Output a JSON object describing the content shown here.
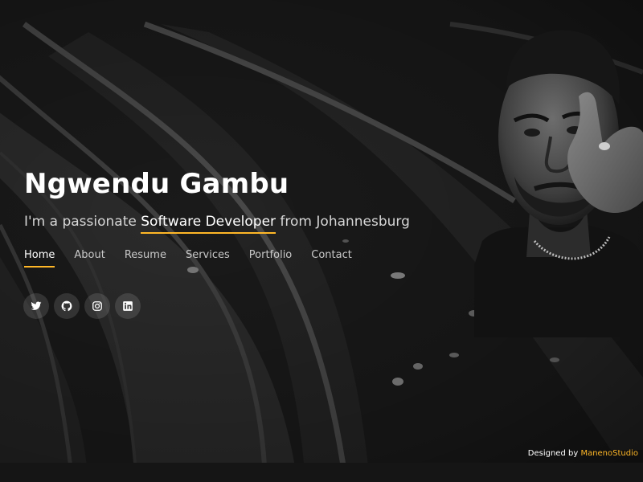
{
  "hero": {
    "name": "Ngwendu Gambu",
    "tagline_prefix": "I'm a passionate ",
    "tagline_typed": "Software Developer",
    "tagline_suffix": " from Johannesburg"
  },
  "nav": {
    "items": [
      {
        "label": "Home",
        "active": true
      },
      {
        "label": "About"
      },
      {
        "label": "Resume"
      },
      {
        "label": "Services"
      },
      {
        "label": "Portfolio"
      },
      {
        "label": "Contact"
      }
    ]
  },
  "socials": {
    "icons": [
      "twitter-icon",
      "github-icon",
      "instagram-icon",
      "linkedin-icon"
    ]
  },
  "footer": {
    "credit_prefix": "Designed by ",
    "credit_link": "ManenoStudio"
  },
  "colors": {
    "accent": "#ffb727",
    "background": "#1b1b1b",
    "text": "#ffffff"
  }
}
